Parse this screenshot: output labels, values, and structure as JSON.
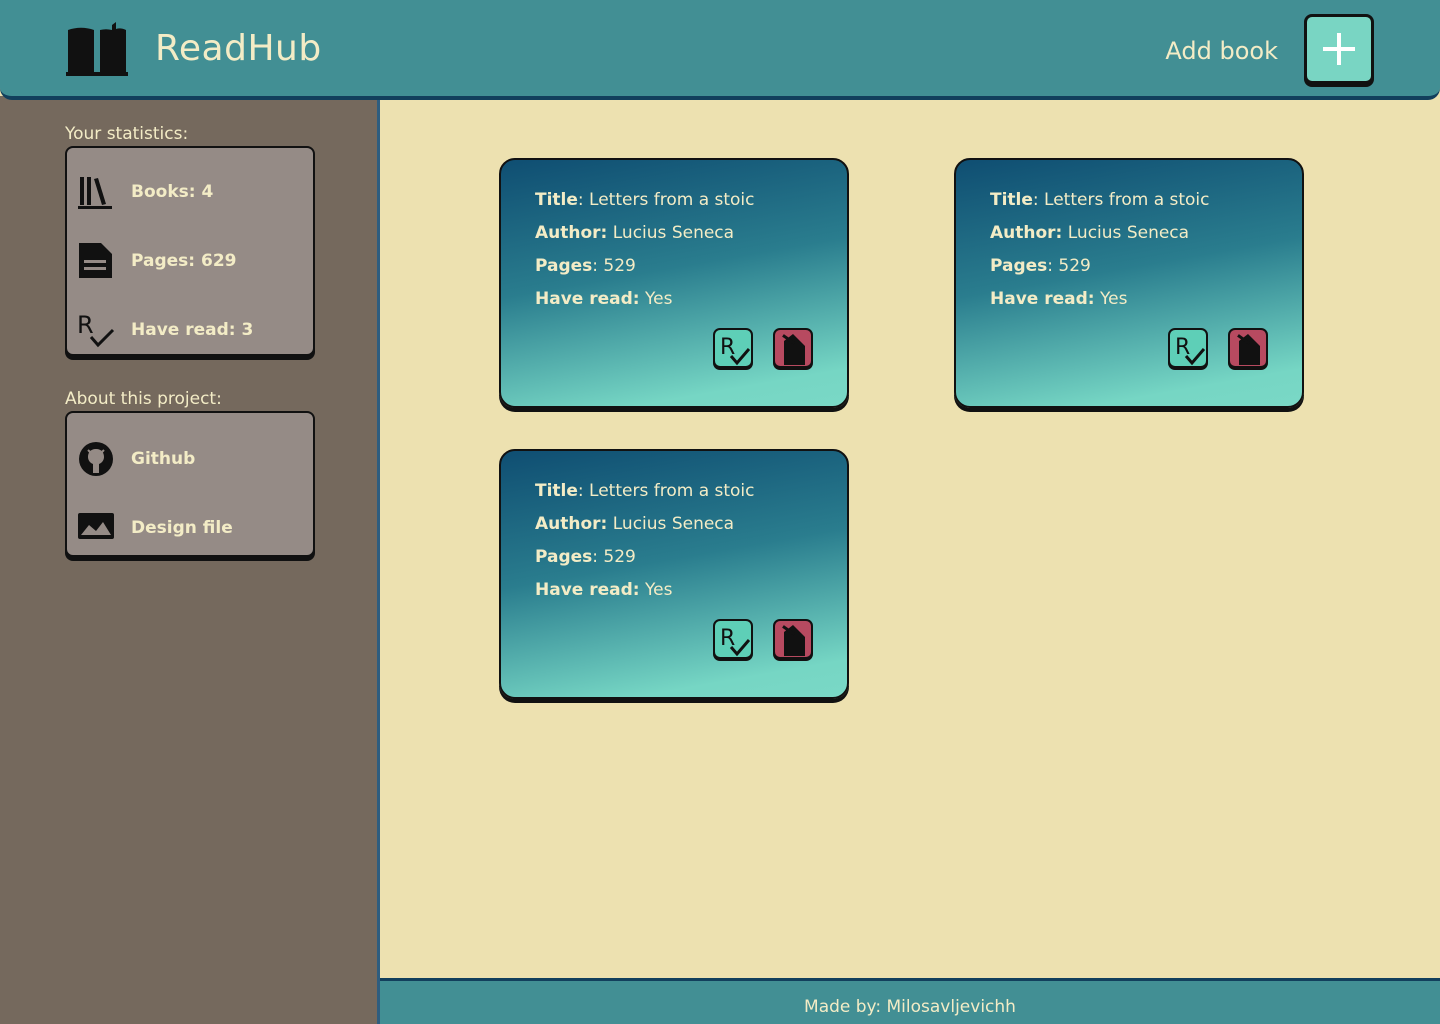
{
  "header": {
    "title": "ReadHub",
    "logo_icon": "open-book-icon",
    "add_label": "Add book",
    "add_icon": "plus-icon"
  },
  "sidebar": {
    "stats_label": "Your statistics:",
    "stats": [
      {
        "label": "Books: 4",
        "icon": "books-icon"
      },
      {
        "label": "Pages: 629",
        "icon": "document-icon"
      },
      {
        "label": "Have read: 3",
        "icon": "read-check-icon"
      }
    ],
    "about_label": "About this project:",
    "links": [
      {
        "label": "Github",
        "icon": "github-icon"
      },
      {
        "label": "Design file",
        "icon": "image-icon"
      }
    ]
  },
  "books": [
    {
      "title_label": "Title",
      "title": ": Letters from a stoic",
      "author_label": "Author:",
      "author": " Lucius Seneca",
      "pages_label": "Pages",
      "pages": ": 529",
      "read_label": "Have read:",
      "read": " Yes"
    },
    {
      "title_label": "Title",
      "title": ": Letters from a stoic",
      "author_label": "Author:",
      "author": " Lucius Seneca",
      "pages_label": "Pages",
      "pages": ": 529",
      "read_label": "Have read:",
      "read": " Yes"
    },
    {
      "title_label": "Title",
      "title": ": Letters from a stoic",
      "author_label": "Author:",
      "author": " Lucius Seneca",
      "pages_label": "Pages",
      "pages": ": 529",
      "read_label": "Have read:",
      "read": " Yes"
    }
  ],
  "footer": {
    "text": "Made by: Milosavljevichh"
  },
  "colors": {
    "header": "#428f94",
    "sidebar": "#75695d",
    "main": "#ede1b0",
    "panel": "#958b86",
    "text": "#f3ecc6",
    "read_button": "#5ecfb7",
    "delete_button": "#b74a60",
    "add_button": "#79d5c3"
  }
}
